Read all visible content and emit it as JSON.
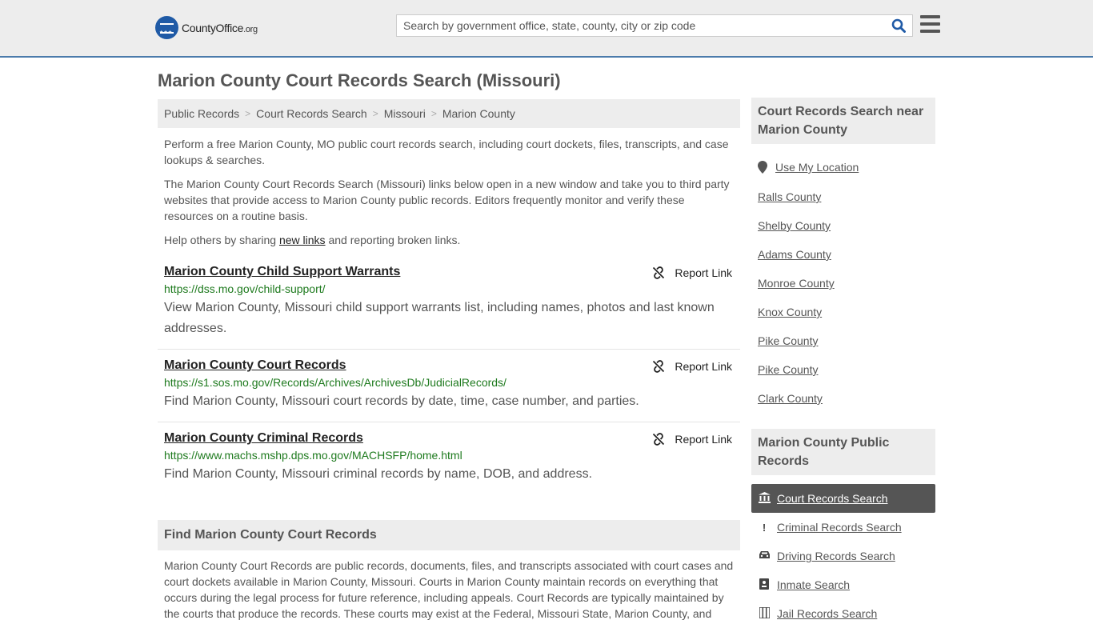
{
  "header": {
    "logo_text": "CountyOffice",
    "logo_suffix": ".org",
    "search_placeholder": "Search by government office, state, county, city or zip code"
  },
  "page_title": "Marion County Court Records Search (Missouri)",
  "breadcrumb": [
    "Public Records",
    "Court Records Search",
    "Missouri",
    "Marion County"
  ],
  "intro": {
    "p1": "Perform a free Marion County, MO public court records search, including court dockets, files, transcripts, and case lookups & searches.",
    "p2": "The Marion County Court Records Search (Missouri) links below open in a new window and take you to third party websites that provide access to Marion County public records. Editors frequently monitor and verify these resources on a routine basis.",
    "p3_before": "Help others by sharing ",
    "p3_link": "new links",
    "p3_after": " and reporting broken links."
  },
  "report_label": "Report Link",
  "results": [
    {
      "title": "Marion County Child Support Warrants",
      "url": "https://dss.mo.gov/child-support/",
      "desc": "View Marion County, Missouri child support warrants list, including names, photos and last known addresses."
    },
    {
      "title": "Marion County Court Records",
      "url": "https://s1.sos.mo.gov/Records/Archives/ArchivesDb/JudicialRecords/",
      "desc": "Find Marion County, Missouri court records by date, time, case number, and parties."
    },
    {
      "title": "Marion County Criminal Records",
      "url": "https://www.machs.mshp.dps.mo.gov/MACHSFP/home.html",
      "desc": "Find Marion County, Missouri criminal records by name, DOB, and address."
    }
  ],
  "find_section": {
    "heading": "Find Marion County Court Records",
    "body": "Marion County Court Records are public records, documents, files, and transcripts associated with court cases and court dockets available in Marion County, Missouri. Courts in Marion County maintain records on everything that occurs during the legal process for future reference, including appeals. Court Records are typically maintained by the courts that produce the records. These courts may exist at the Federal, Missouri State, Marion County, and"
  },
  "sidebar": {
    "near_heading": "Court Records Search near Marion County",
    "use_location": "Use My Location",
    "counties": [
      "Ralls County",
      "Shelby County",
      "Adams County",
      "Monroe County",
      "Knox County",
      "Pike County",
      "Pike County",
      "Clark County"
    ],
    "public_heading": "Marion County Public Records",
    "nav": [
      {
        "label": "Court Records Search",
        "icon": "courthouse-icon",
        "active": true
      },
      {
        "label": "Criminal Records Search",
        "icon": "exclamation-icon",
        "active": false
      },
      {
        "label": "Driving Records Search",
        "icon": "car-icon",
        "active": false
      },
      {
        "label": "Inmate Search",
        "icon": "id-card-icon",
        "active": false
      },
      {
        "label": "Jail Records Search",
        "icon": "jail-icon",
        "active": false
      }
    ]
  }
}
